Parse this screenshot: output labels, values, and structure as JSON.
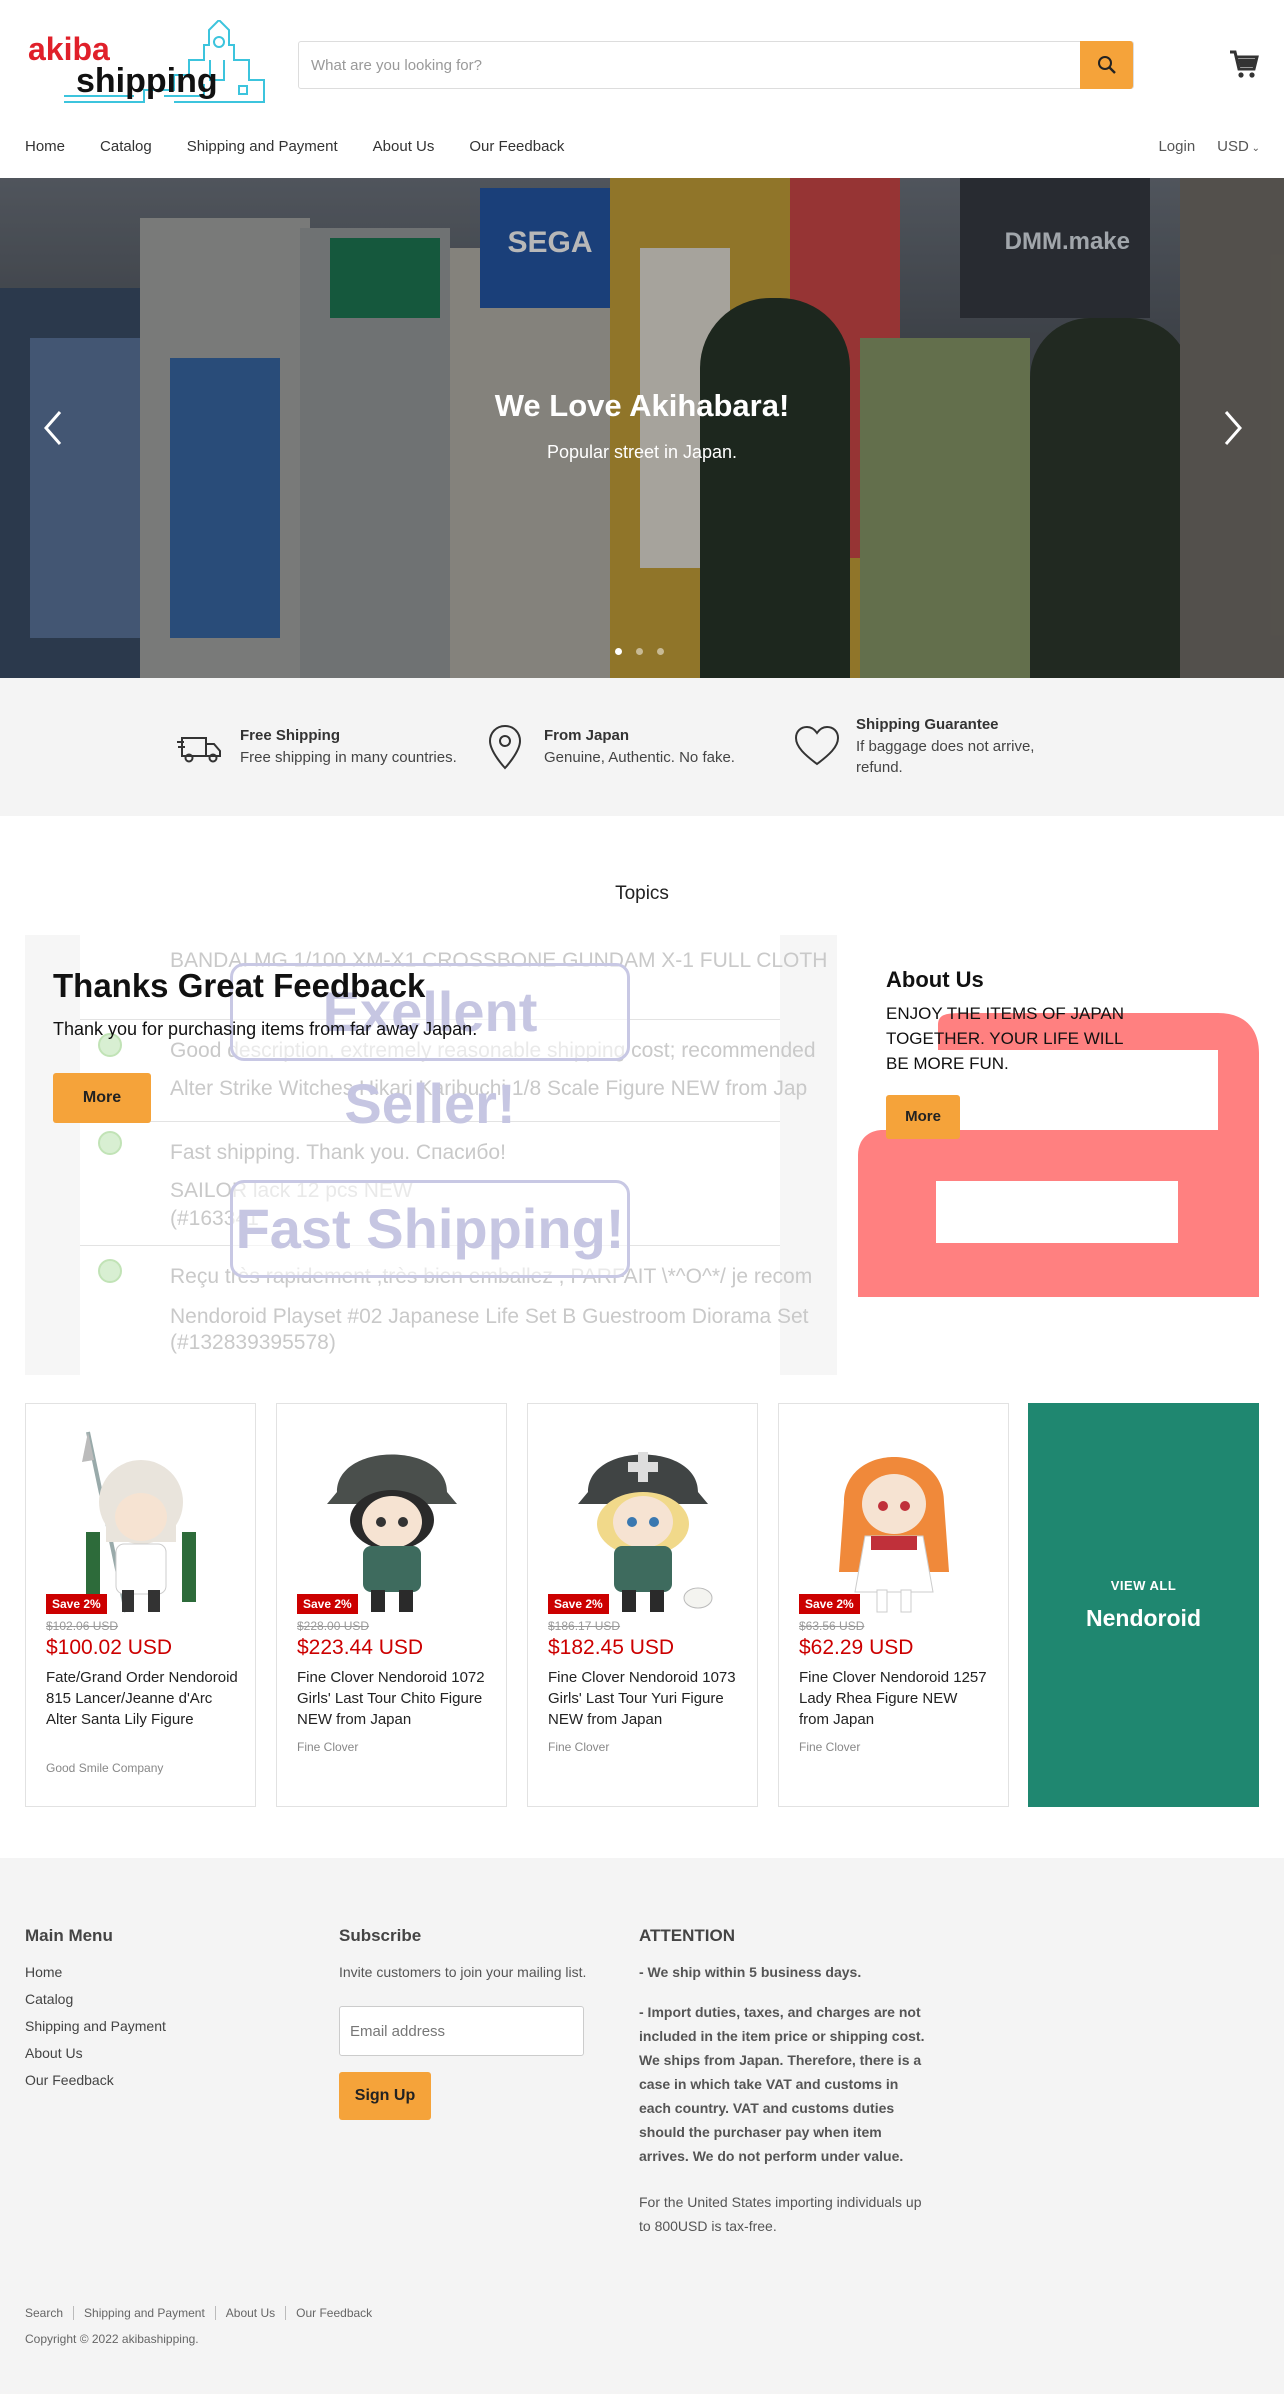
{
  "header": {
    "logo_text_top": "akiba",
    "logo_text_bottom": "shipping",
    "search_placeholder": "What are you looking for?",
    "icons": {
      "search": "search-icon",
      "cart": "cart-icon"
    }
  },
  "nav": {
    "items": [
      "Home",
      "Catalog",
      "Shipping and Payment",
      "About Us",
      "Our Feedback"
    ],
    "login": "Login",
    "currency": "USD"
  },
  "hero": {
    "title": "We Love Akihabara!",
    "subtitle": "Popular street in Japan.",
    "signs": [
      "SEGA",
      "DMM.make"
    ],
    "slide_count": 3,
    "active_slide": 1
  },
  "features": [
    {
      "icon": "truck-icon",
      "title": "Free Shipping",
      "text": "Free shipping in many countries."
    },
    {
      "icon": "map-pin-icon",
      "title": "From Japan",
      "text": "Genuine, Authentic. No fake."
    },
    {
      "icon": "heart-icon",
      "title": "Shipping Guarantee",
      "text": "If baggage does not arrive, refund."
    }
  ],
  "topics": {
    "title": "Topics",
    "left": {
      "heading": "Thanks Great Feedback",
      "text": "Thank you for purchasing items from far away Japan.",
      "button": "More",
      "bg_lines": [
        "BANDAI MG 1/100 XM-X1 CROSSBONE GUNDAM X-1 FULL CLOTH",
        "Good description, extremely reasonable shipping cost; recommended",
        "Alter Strike Witches Hikari Karibuchi 1/8 Scale Figure NEW from Jap",
        "Fast shipping. Thank you. Спасибо!",
        "SAILOR                                      lack 12 pcs NEW",
        "(#163341",
        "Reçu très rapidement ,très bien emballez , PARFAIT \\*^O^*/ je recom",
        "Nendoroid Playset #02 Japanese Life Set B Guestroom Diorama Set",
        "(#132839395578)"
      ],
      "bubbles": [
        "Exellent Seller!",
        "Fast Shipping!"
      ]
    },
    "right": {
      "heading": "About Us",
      "text": "ENJOY THE ITEMS OF JAPAN TOGETHER. YOUR LIFE WILL BE MORE FUN.",
      "button": "More"
    }
  },
  "products": [
    {
      "badge": "Save 2%",
      "old_price": "$102.06 USD",
      "price": "$100.02 USD",
      "name": "Fate/Grand Order Nendoroid 815 Lancer/Jeanne d'Arc Alter Santa Lily Figure",
      "vendor": "Good Smile Company",
      "hair": "#e9e4dc",
      "outfit": "#ffffff",
      "accent": "#2d6b3a"
    },
    {
      "badge": "Save 2%",
      "old_price": "$228.00 USD",
      "price": "$223.44 USD",
      "name": "Fine Clover Nendoroid 1072 Girls' Last Tour Chito Figure NEW from Japan",
      "vendor": "Fine Clover",
      "hair": "#2a2a2a",
      "outfit": "#3e6b5e",
      "accent": "#4a4f4c"
    },
    {
      "badge": "Save 2%",
      "old_price": "$186.17 USD",
      "price": "$182.45 USD",
      "name": "Fine Clover Nendoroid 1073 Girls' Last Tour Yuri Figure NEW from Japan",
      "vendor": "Fine Clover",
      "hair": "#f1d98a",
      "outfit": "#3e6b5e",
      "accent": "#404444"
    },
    {
      "badge": "Save 2%",
      "old_price": "$63.56 USD",
      "price": "$62.29 USD",
      "name": "Fine Clover Nendoroid 1257 Lady Rhea Figure NEW from Japan",
      "vendor": "Fine Clover",
      "hair": "#f0893a",
      "outfit": "#ffffff",
      "accent": "#c0303a"
    }
  ],
  "view_all": {
    "small": "VIEW ALL",
    "big": "Nendoroid"
  },
  "footer": {
    "menu_heading": "Main Menu",
    "menu": [
      "Home",
      "Catalog",
      "Shipping and Payment",
      "About Us",
      "Our Feedback"
    ],
    "subscribe_heading": "Subscribe",
    "subscribe_text": "Invite customers to join your mailing list.",
    "email_placeholder": "Email address",
    "signup": "Sign Up",
    "attention_heading": "ATTENTION",
    "attention_1": "- We ship within 5 business days.",
    "attention_2": "- Import duties, taxes, and charges are not included in the item price or shipping cost. We ships from Japan. Therefore, there is a case in which take VAT and customs in each country. VAT and customs duties should the purchaser pay when item arrives. We do not perform under value.",
    "attention_3": "For the United States importing individuals up to 800USD is tax-free.",
    "bottom_links": [
      "Search",
      "Shipping and Payment",
      "About Us",
      "Our Feedback"
    ],
    "copyright": "Copyright © 2022 akibashipping."
  },
  "colors": {
    "accent": "#f5a33a",
    "sale": "#cc0000",
    "teal": "#1f8770",
    "logo_blue": "#3cc4dd",
    "logo_red": "#e0202a"
  }
}
